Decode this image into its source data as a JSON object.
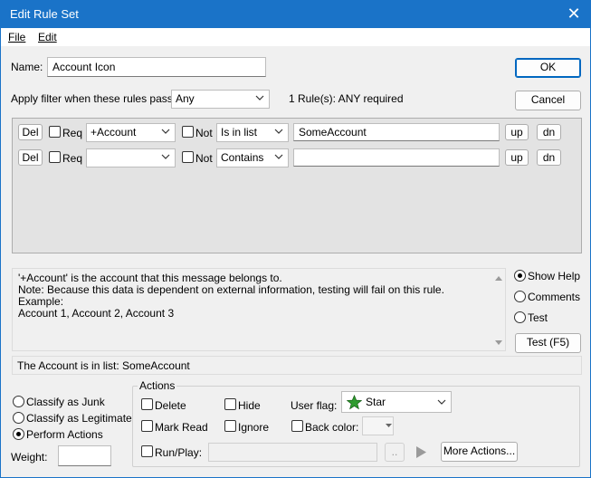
{
  "window": {
    "title": "Edit Rule Set",
    "close_glyph": "✕"
  },
  "menu": {
    "file": "File",
    "edit": "Edit"
  },
  "name": {
    "label": "Name:",
    "value": "Account Icon"
  },
  "filter": {
    "label": "Apply filter when these rules pass:",
    "value": "Any",
    "summary": "1 Rule(s): ANY required"
  },
  "buttons": {
    "ok": "OK",
    "cancel": "Cancel",
    "test": "Test (F5)",
    "more_actions": "More Actions..."
  },
  "rules": [
    {
      "del": "Del",
      "req": "Req",
      "field": "+Account",
      "not": "Not",
      "op": "Is in list",
      "value": "SomeAccount",
      "up": "up",
      "dn": "dn"
    },
    {
      "del": "Del",
      "req": "Req",
      "field": "",
      "not": "Not",
      "op": "Contains",
      "value": "",
      "up": "up",
      "dn": "dn"
    }
  ],
  "help": {
    "lines": [
      "'+Account' is the account that this message belongs to.",
      "Note: Because this data is dependent on external information, testing will fail on this rule.",
      "Example:",
      "Account 1, Account 2, Account 3"
    ],
    "options": {
      "show_help": "Show Help",
      "comments": "Comments",
      "test": "Test"
    },
    "selected": "show_help"
  },
  "summary_line": "The Account is in list: SomeAccount",
  "classify": {
    "junk": "Classify as Junk",
    "legit": "Classify as Legitimate",
    "perform": "Perform Actions",
    "selected": "perform"
  },
  "weight": {
    "label": "Weight:",
    "value": ""
  },
  "actions": {
    "legend": "Actions",
    "delete": "Delete",
    "hide": "Hide",
    "mark_read": "Mark Read",
    "ignore": "Ignore",
    "user_flag_label": "User flag:",
    "user_flag_value": "Star",
    "back_color_label": "Back color:",
    "run_play": "Run/Play:",
    "browse": "..",
    "colors": {
      "star": "#2e9b2e"
    }
  }
}
